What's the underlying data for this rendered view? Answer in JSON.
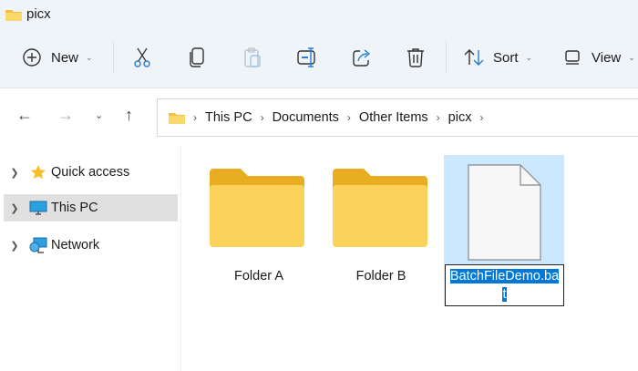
{
  "window": {
    "title": "picx"
  },
  "toolbar": {
    "new_label": "New",
    "sort_label": "Sort",
    "view_label": "View",
    "icons": [
      "plus-circle-icon",
      "cut-icon",
      "copy-icon",
      "paste-icon",
      "rename-icon",
      "share-icon",
      "delete-icon",
      "sort-icon",
      "view-icon"
    ]
  },
  "breadcrumb": [
    "This PC",
    "Documents",
    "Other Items",
    "picx"
  ],
  "sidebar": {
    "items": [
      {
        "label": "Quick access",
        "icon": "star-icon"
      },
      {
        "label": "This PC",
        "icon": "monitor-icon",
        "selected": true
      },
      {
        "label": "Network",
        "icon": "network-icon"
      }
    ]
  },
  "files": [
    {
      "name": "Folder A",
      "type": "folder"
    },
    {
      "name": "Folder B",
      "type": "folder"
    },
    {
      "name": "BatchFileDemo.bat",
      "type": "file",
      "rename_line1": "BatchFileDemo.ba",
      "rename_line2": "t",
      "selected": true
    }
  ],
  "colors": {
    "selection": "#cce8ff",
    "text_highlight": "#0078d7",
    "folder": "#f8c93e"
  }
}
